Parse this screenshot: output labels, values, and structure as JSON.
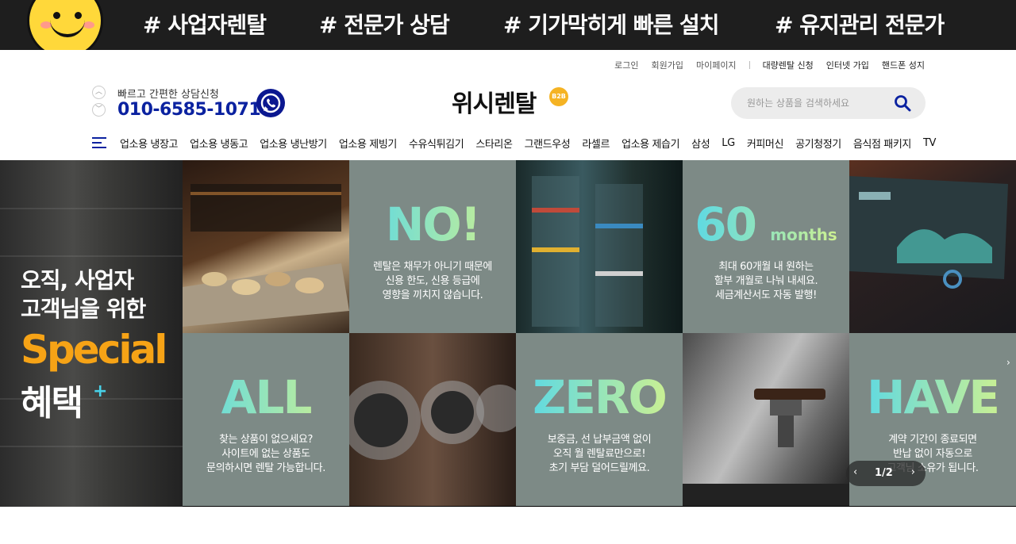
{
  "top_banner": {
    "tags": [
      "# 사업자렌탈",
      "# 전문가 상담",
      "# 기가막히게 빠른 설치",
      "# 유지관리 전문가"
    ]
  },
  "util_links": {
    "login": "로그인",
    "signup": "회원가입",
    "mypage": "마이페이지",
    "bulk_rental": "대량렌탈 신청",
    "internet": "인터넷 가입",
    "phone_store": "핸드폰 성지"
  },
  "counsel": {
    "caption": "빠르고 간편한 상담신청",
    "phone": "010-6585-1071"
  },
  "logo": {
    "text": "위시렌탈",
    "badge": "B2B"
  },
  "search": {
    "placeholder": "원하는 상품을 검색하세요"
  },
  "nav": {
    "items": [
      "업소용 냉장고",
      "업소용 냉동고",
      "업소용 냉난방기",
      "업소용 제빙기",
      "수유식튀김기",
      "스타리온",
      "그랜드우성",
      "라셀르",
      "업소용 제습기",
      "삼성",
      "LG",
      "커피머신",
      "공기청정기",
      "음식점 패키지",
      "TV"
    ]
  },
  "hero": {
    "promo": {
      "line1": "오직, 사업자",
      "line2": "고객님을 위한",
      "special": "Special",
      "benefit": "혜택",
      "plus": "+"
    },
    "panels": {
      "no": {
        "title": "NO!",
        "desc": "렌탈은 채무가 아니기 때문에\n신용 한도, 신용 등급에\n영향을 끼치지 않습니다."
      },
      "months": {
        "title": "60",
        "unit": "months",
        "desc": "최대 60개월 내 원하는\n할부 개월로 나눠 내세요.\n세금계산서도 자동 발행!"
      },
      "all": {
        "title": "ALL",
        "desc": "찾는 상품이 없으세요?\n사이트에 없는 상품도\n문의하시면 렌탈 가능합니다."
      },
      "zero": {
        "title": "ZERO",
        "desc": "보증금, 선 납부금액 없이\n오직 월 렌탈료만으로!\n초기 부담 덜어드릴께요."
      },
      "have": {
        "title": "HAVE",
        "desc": "계약 기간이 종료되면\n반납 없이 자동으로\n고객님 소유가 됩니다."
      }
    },
    "pager": {
      "prev": "‹",
      "current": "1/2",
      "next": "›"
    }
  },
  "colors": {
    "banner_bg": "#1e1e1e",
    "brand_blue": "#0b22a0",
    "panel_gray": "#7d8a86",
    "special_orange": "#f6a316",
    "badge_yellow": "#f5b323"
  }
}
